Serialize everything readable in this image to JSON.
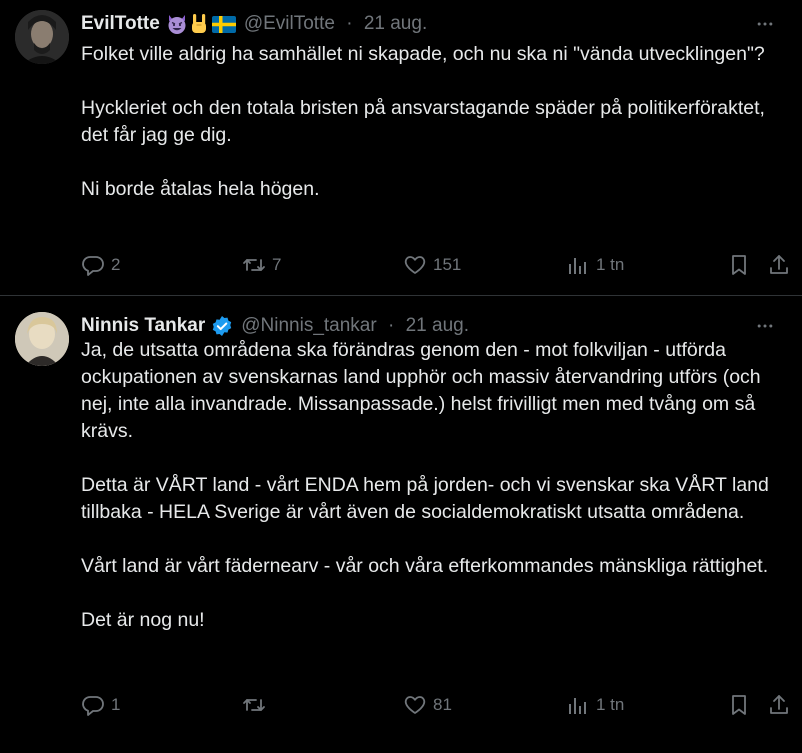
{
  "tweets": [
    {
      "display_name": "EvilTotte",
      "emojis": [
        "smiling-devil",
        "rock-on-hand",
        "swedish-flag"
      ],
      "handle": "@EvilTotte",
      "separator": "·",
      "date": "21 aug.",
      "paragraphs": [
        "Folket ville aldrig ha samhället ni skapade, och nu ska ni \"vända utvecklingen\"?",
        "Hyckleriet och den totala bristen på ansvarstagande späder på politikerföraktet, det får jag ge dig.",
        "Ni borde åtalas hela högen."
      ],
      "replies": "2",
      "reposts": "7",
      "likes": "151",
      "views": "1 tn"
    },
    {
      "display_name": "Ninnis Tankar",
      "verified": true,
      "handle": "@Ninnis_tankar",
      "separator": "·",
      "date": "21 aug.",
      "paragraphs": [
        "Ja, de utsatta områdena ska förändras genom den - mot folkviljan - utförda ockupationen av svenskarnas land upphör och massiv återvandring utförs (och nej, inte alla invandrade. Missanpassade.) helst frivilligt men med tvång om så krävs.",
        "Detta är VÅRT land - vårt ENDA hem på jorden- och vi svenskar ska VÅRT land tillbaka - HELA Sverige är vårt även de socialdemokratiskt utsatta områdena.",
        "Vårt land är vårt fädernearv - vår och våra efterkommandes mänskliga rättighet.",
        "Det är nog nu!"
      ],
      "replies": "1",
      "reposts": "",
      "likes": "81",
      "views": "1 tn"
    }
  ],
  "colors": {
    "background": "#000000",
    "text": "#e7e9ea",
    "muted": "#71767b",
    "divider": "#2f3336",
    "verified_blue": "#1d9bf0"
  },
  "icons": {
    "reply": "reply-icon",
    "repost": "repost-icon",
    "like": "heart-icon",
    "views": "views-icon",
    "bookmark": "bookmark-icon",
    "share": "share-icon",
    "more": "more-icon"
  }
}
